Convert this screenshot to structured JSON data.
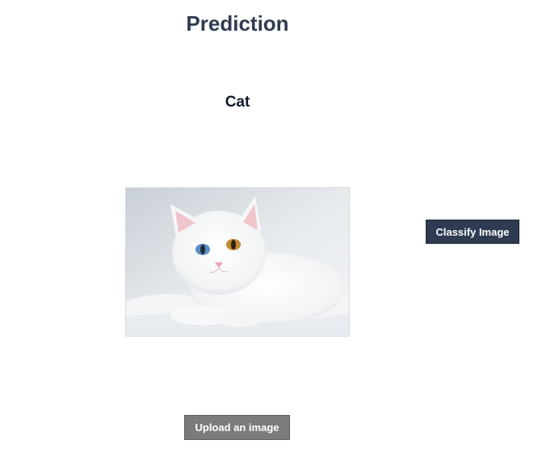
{
  "page": {
    "title": "Prediction",
    "result": "Cat"
  },
  "image": {
    "subject": "white-cat-photo"
  },
  "buttons": {
    "classify_label": "Classify Image",
    "upload_label": "Upload an image"
  },
  "colors": {
    "title": "#2f3b52",
    "result": "#0f1a2e",
    "classify_bg": "#2f3b52",
    "upload_bg": "#7b7b7b"
  }
}
